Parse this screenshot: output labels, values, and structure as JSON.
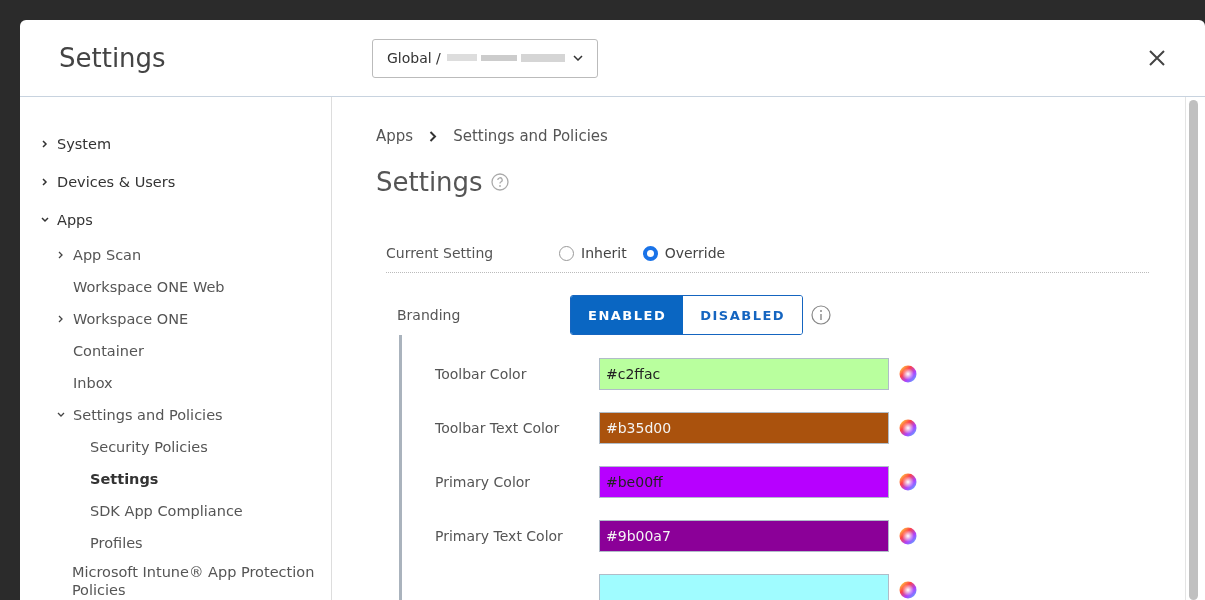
{
  "dialog": {
    "title": "Settings",
    "scope_dropdown": {
      "value": "Global /"
    }
  },
  "sidebar": {
    "items": [
      {
        "label": "System",
        "expanded": false,
        "selected": false
      },
      {
        "label": "Devices & Users",
        "expanded": false,
        "selected": false
      },
      {
        "label": "Apps",
        "expanded": true,
        "selected": false,
        "children": [
          {
            "label": "App Scan",
            "expanded": false,
            "selected": false
          },
          {
            "label": "Workspace ONE Web",
            "selected": false
          },
          {
            "label": "Workspace ONE",
            "expanded": false,
            "selected": false
          },
          {
            "label": "Container",
            "selected": false
          },
          {
            "label": "Inbox",
            "selected": false
          },
          {
            "label": "Settings and Policies",
            "expanded": true,
            "selected": false,
            "children": [
              {
                "label": "Security Policies",
                "selected": false
              },
              {
                "label": "Settings",
                "selected": true
              },
              {
                "label": "SDK App Compliance",
                "selected": false
              },
              {
                "label": "Profiles",
                "selected": false
              }
            ]
          },
          {
            "label": "Microsoft Intune® App Protection Policies",
            "selected": false
          }
        ]
      }
    ]
  },
  "breadcrumb": [
    "Apps",
    "Settings and Policies"
  ],
  "heading": "Settings",
  "current_setting": {
    "label": "Current Setting",
    "options": [
      {
        "label": "Inherit",
        "selected": false
      },
      {
        "label": "Override",
        "selected": true
      }
    ]
  },
  "branding": {
    "label": "Branding",
    "options": [
      {
        "label": "ENABLED",
        "selected": true
      },
      {
        "label": "DISABLED",
        "selected": false
      }
    ]
  },
  "colors": [
    {
      "label": "Toolbar Color",
      "value": "#c2ffac",
      "color": "#b9ff9e",
      "light_text": false
    },
    {
      "label": "Toolbar Text Color",
      "value": "#b35d00",
      "color": "#aa520d",
      "light_text": true
    },
    {
      "label": "Primary Color",
      "value": "#be00ff",
      "color": "#b700ff",
      "light_text": false
    },
    {
      "label": "Primary Text Color",
      "value": "#9b00a7",
      "color": "#8b0098",
      "light_text": true
    },
    {
      "color": "#a0fcff"
    }
  ]
}
